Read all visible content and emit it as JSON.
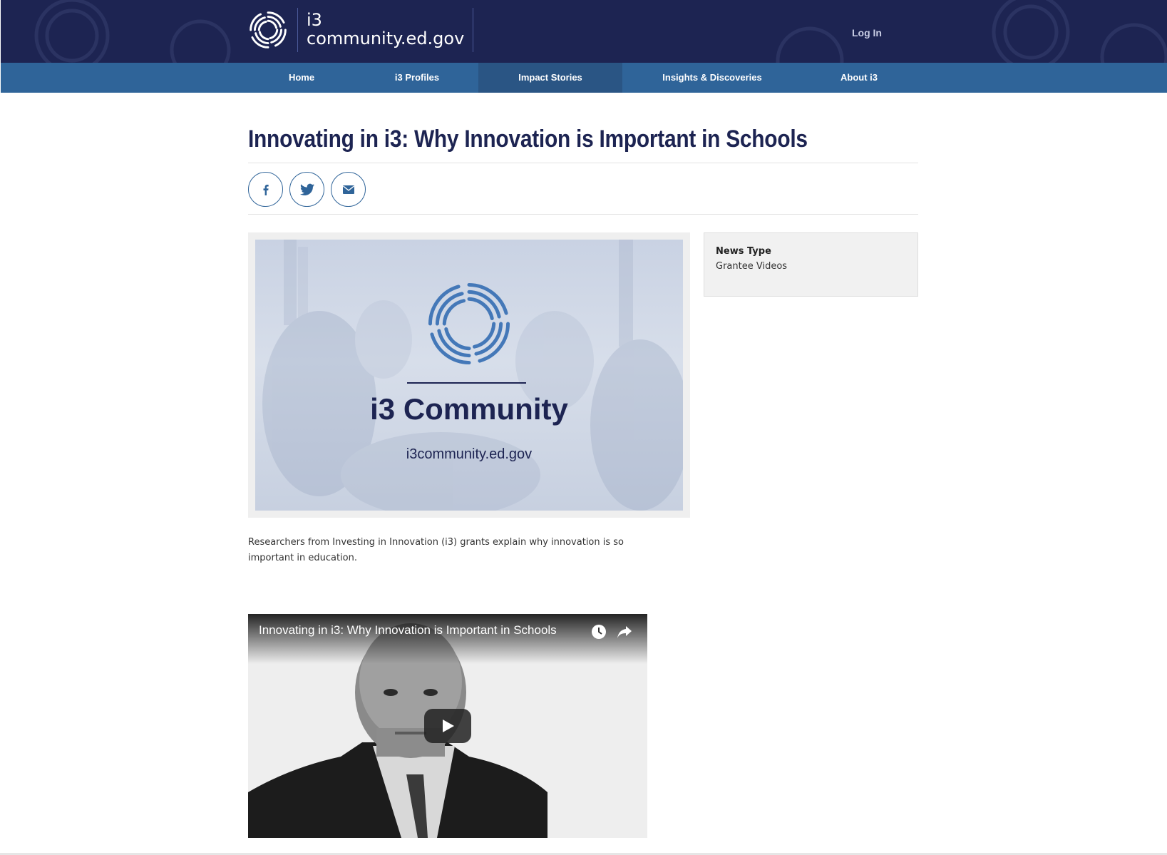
{
  "header": {
    "brand_line1": "i3",
    "brand_line2": "community.ed.gov",
    "login_label": "Log In"
  },
  "nav": {
    "items": [
      {
        "label": "Home"
      },
      {
        "label": "i3 Profiles"
      },
      {
        "label": "Impact Stories"
      },
      {
        "label": "Insights & Discoveries"
      },
      {
        "label": "About i3"
      }
    ],
    "active": "Impact Stories"
  },
  "article": {
    "title": "Innovating in i3: Why Innovation is Important in Schools",
    "description": "Researchers from Investing in Innovation (i3) grants explain why innovation is so important in education."
  },
  "share": {
    "facebook_icon": "facebook-icon",
    "twitter_icon": "twitter-icon",
    "email_icon": "email-icon"
  },
  "feature_image": {
    "title": "i3 Community",
    "url": "i3community.ed.gov"
  },
  "sidebar": {
    "news_type_label": "News Type",
    "news_type_value": "Grantee Videos"
  },
  "video": {
    "title": "Innovating in i3: Why Innovation is Important in Schools",
    "watch_later_icon": "clock-icon",
    "share_icon": "share-arrow-icon",
    "play_icon": "play-icon"
  },
  "colors": {
    "header_bg": "#1d2452",
    "nav_bg": "#2f6499",
    "nav_active_bg": "#2a5584",
    "title_color": "#1d2452"
  }
}
